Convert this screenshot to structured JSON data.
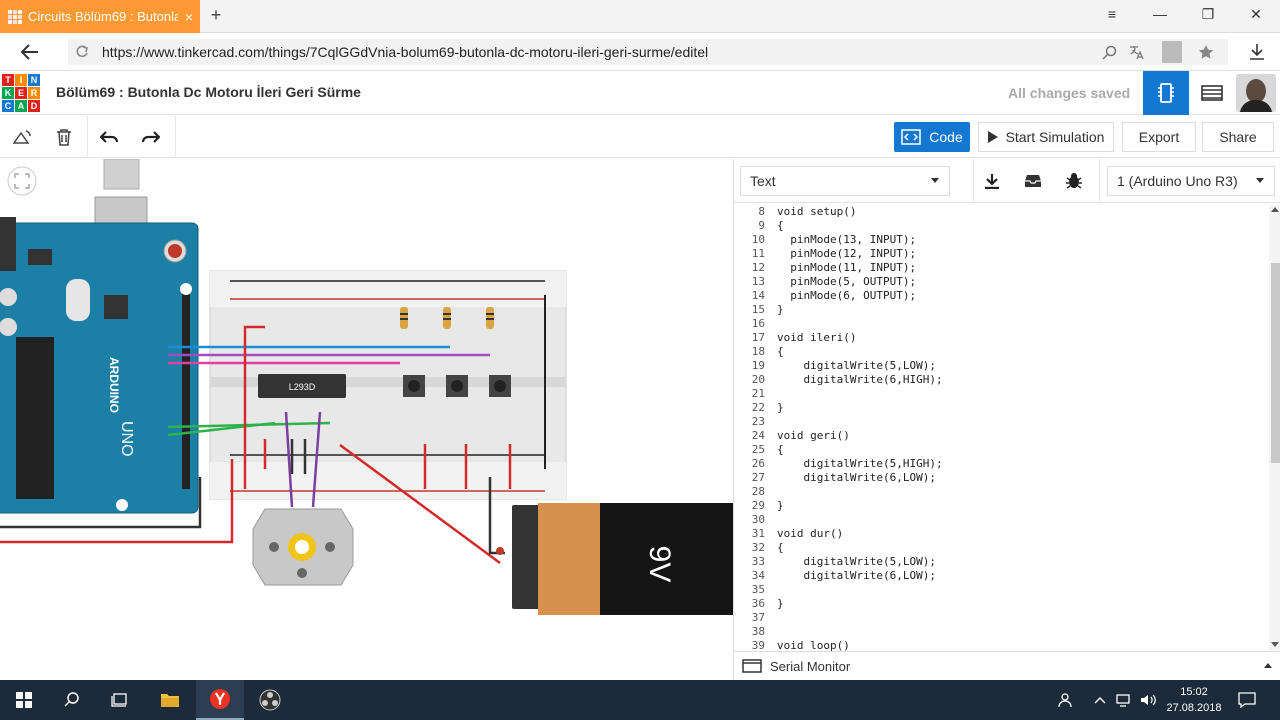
{
  "browser": {
    "tab_title": "Circuits Bölüm69 : Butonla",
    "tab_close": "×",
    "new_tab": "+",
    "url": "https://www.tinkercad.com/things/7CqlGGdVnia-bolum69-butonla-dc-motoru-ileri-geri-surme/editel",
    "win_menu": "≡",
    "win_min": "—",
    "win_restore": "❐",
    "win_close": "✕"
  },
  "app": {
    "logo_letters": [
      "TIN",
      "KER",
      "CAD"
    ],
    "logo_colors": [
      "#e2201c",
      "#ff8c00",
      "#1477d2",
      "#00a651",
      "#e2201c",
      "#ff8c00",
      "#1477d2",
      "#00a651",
      "#e2201c"
    ],
    "logo_cells": [
      "T",
      "I",
      "N",
      "K",
      "E",
      "R",
      "C",
      "A",
      "D"
    ],
    "title": "Bölüm69 : Butonla Dc Motoru İleri Geri Sürme",
    "save_status": "All changes saved"
  },
  "toolbar": {
    "code_label": "Code",
    "sim_label": "Start Simulation",
    "export_label": "Export",
    "share_label": "Share"
  },
  "canvas": {
    "chip_label": "L293D",
    "battery_label": "9V",
    "arduino_label": "ARDUINO",
    "uno_label": "UNO"
  },
  "code": {
    "mode": "Text",
    "board": "1 (Arduino Uno R3)",
    "lines": [
      {
        "n": "8",
        "t": "void setup()"
      },
      {
        "n": "9",
        "t": "{"
      },
      {
        "n": "10",
        "t": "  pinMode(13, INPUT);"
      },
      {
        "n": "11",
        "t": "  pinMode(12, INPUT);"
      },
      {
        "n": "12",
        "t": "  pinMode(11, INPUT);"
      },
      {
        "n": "13",
        "t": "  pinMode(5, OUTPUT);"
      },
      {
        "n": "14",
        "t": "  pinMode(6, OUTPUT);"
      },
      {
        "n": "15",
        "t": "}"
      },
      {
        "n": "16",
        "t": ""
      },
      {
        "n": "17",
        "t": "void ileri()"
      },
      {
        "n": "18",
        "t": "{"
      },
      {
        "n": "19",
        "t": "    digitalWrite(5,LOW);"
      },
      {
        "n": "20",
        "t": "    digitalWrite(6,HIGH);"
      },
      {
        "n": "21",
        "t": ""
      },
      {
        "n": "22",
        "t": "}"
      },
      {
        "n": "23",
        "t": ""
      },
      {
        "n": "24",
        "t": "void geri()"
      },
      {
        "n": "25",
        "t": "{"
      },
      {
        "n": "26",
        "t": "    digitalWrite(5,HIGH);"
      },
      {
        "n": "27",
        "t": "    digitalWrite(6,LOW);"
      },
      {
        "n": "28",
        "t": ""
      },
      {
        "n": "29",
        "t": "}"
      },
      {
        "n": "30",
        "t": ""
      },
      {
        "n": "31",
        "t": "void dur()"
      },
      {
        "n": "32",
        "t": "{"
      },
      {
        "n": "33",
        "t": "    digitalWrite(5,LOW);"
      },
      {
        "n": "34",
        "t": "    digitalWrite(6,LOW);"
      },
      {
        "n": "35",
        "t": ""
      },
      {
        "n": "36",
        "t": "}"
      },
      {
        "n": "37",
        "t": ""
      },
      {
        "n": "38",
        "t": ""
      },
      {
        "n": "39",
        "t": "void loop()"
      }
    ],
    "serial_monitor": "Serial Monitor"
  },
  "taskbar": {
    "time": "15:02",
    "date": "27.08.2018"
  }
}
